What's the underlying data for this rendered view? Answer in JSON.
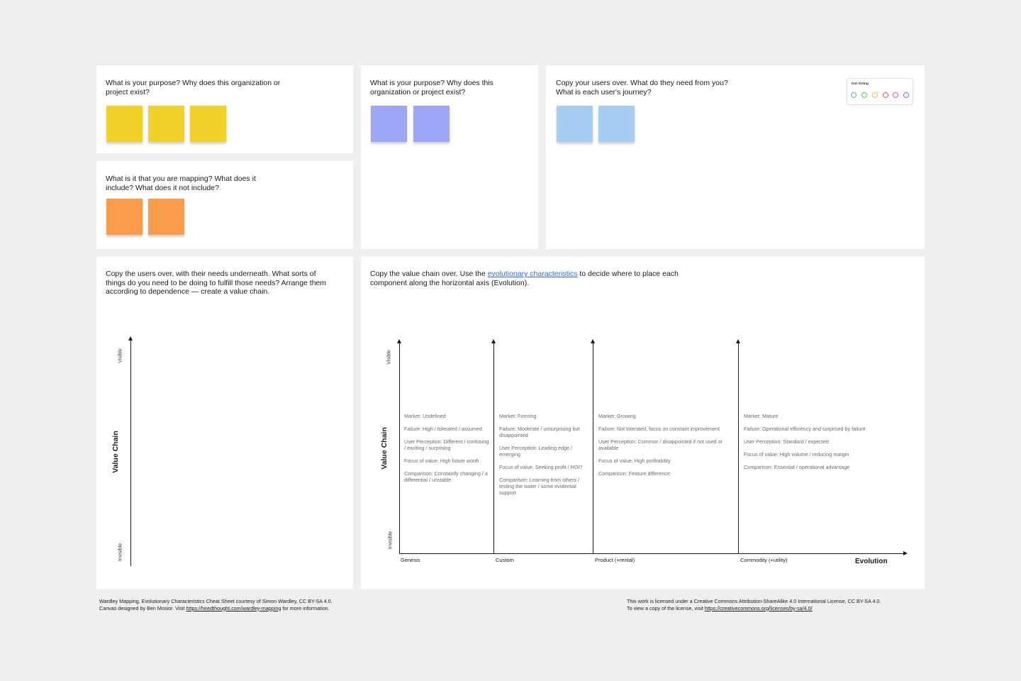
{
  "panels": {
    "purpose_a": {
      "prompt": "What is your purpose? Why does this organization or project exist?"
    },
    "mapping": {
      "prompt": "What is it that you are mapping? What does it include? What does it not include?"
    },
    "purpose_b": {
      "prompt": "What is your purpose? Why does this organization or project exist?"
    },
    "users": {
      "prompt": "Copy your users over. What do they need from you? What is each user's journey?"
    },
    "value_chain": {
      "prompt": "Copy the users over, with their needs underneath. What sorts of things do you need to be doing to fulfill those needs? Arrange them according to dependence — create a value chain.",
      "axis_label": "Value Chain",
      "top_label": "Visible",
      "bottom_label": "Invisible"
    },
    "evolution": {
      "prompt_before": "Copy the value chain over. Use the ",
      "prompt_link": "evolutionary characteristics",
      "prompt_after": " to decide where to place each component along the horizontal axis (Evolution).",
      "axis_label": "Value Chain",
      "top_label": "Visible",
      "bottom_label": "Invisible",
      "x_axis_label": "Evolution",
      "stages": [
        "Genesis",
        "Custom",
        "Product (+rental)",
        "Commodity (+utility)"
      ],
      "characteristics": [
        [
          "Market: Undefined",
          "Failure: High / tolerated / assumed",
          "User Perception: Different / confusing / exciting / surprising",
          "Focus of value: High future worth",
          "Comparison: Constantly changing / a differential / unstable"
        ],
        [
          "Market: Forming",
          "Failure: Moderate / unsurprising but disappointed",
          "User Perception: Leading edge / emerging",
          "Focus of value: Seeking profit / ROI?",
          "Comparison: Learning from others / testing the water / some evidential support"
        ],
        [
          "Market: Growing",
          "Failure: Not tolerated, focus on constant improvement",
          "User Perception: Common / disappointed if not used or available",
          "Focus of value: High profitability",
          "Comparison: Feature difference"
        ],
        [
          "Market: Mature",
          "Failure: Operational efficiency and surprised by failure",
          "User Perception: Standard / expected",
          "Focus of value: High volume / reducing margin",
          "Comparison: Essential / operational advantage"
        ]
      ]
    }
  },
  "dot_voting": {
    "title": "Dot Voting",
    "dot_colors": [
      "#4fb3c9",
      "#5ec26a",
      "#e6c23a",
      "#e0556b",
      "#d65ac4",
      "#7b6fe0"
    ]
  },
  "colors": {
    "yellow": "#f2d22a",
    "orange": "#f99c4b",
    "purple": "#9ea6f8",
    "blue": "#a8cdf3"
  },
  "footer": {
    "left_line1": "Wardley Mapping, Evolutionary Characteristics Cheat Sheet courtesy of Simon Wardley, CC BY-SA 4.0.",
    "left_line2_prefix": "Canvas designed by Ben Mosior. Visit ",
    "left_link": "https://hiredthought.com/wardley-mapping",
    "left_line2_suffix": " for more information.",
    "right_line1": "This work is licensed under a Creative Commons Attribution-ShareAlike 4.0 International License, CC BY-SA 4.0.",
    "right_line2_prefix": "To view a copy of the license, visit ",
    "right_link": "https://creativecommons.org/licenses/by-sa/4.0/"
  }
}
